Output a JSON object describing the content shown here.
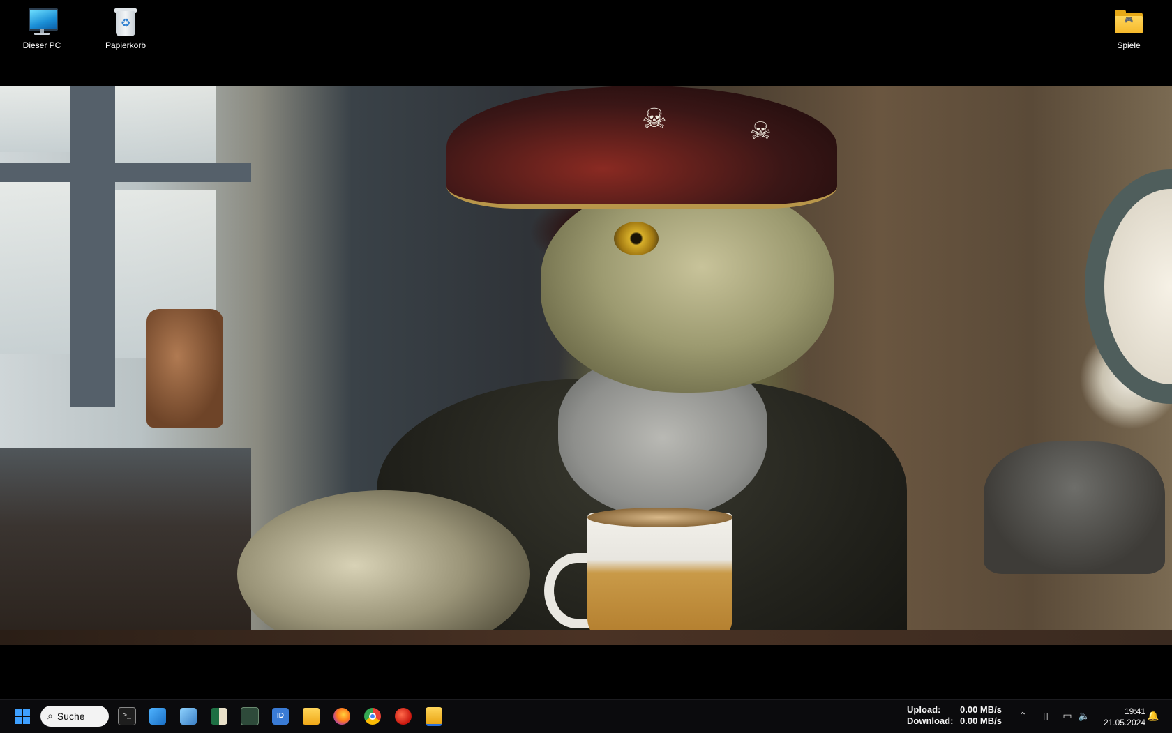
{
  "desktop": {
    "icons": [
      {
        "label": "Dieser PC",
        "icon": "computer-icon"
      },
      {
        "label": "Papierkorb",
        "icon": "recycle-bin-icon"
      },
      {
        "label": "Spiele",
        "icon": "folder-icon"
      }
    ]
  },
  "taskbar": {
    "search_label": "Suche",
    "apps": [
      "terminal-icon",
      "remote-desktop-icon",
      "control-panel-icon",
      "excel-icon",
      "gpu-monitor-icon",
      "id-app-icon",
      "file-explorer-icon",
      "firefox-icon",
      "chrome-icon",
      "media-player-icon",
      "folder-icon"
    ],
    "network": {
      "upload_label": "Upload:",
      "upload_value": "0.00 MB/s",
      "download_label": "Download:",
      "download_value": "0.00 MB/s"
    },
    "clock": {
      "time": "19:41",
      "date": "21.05.2024"
    }
  }
}
